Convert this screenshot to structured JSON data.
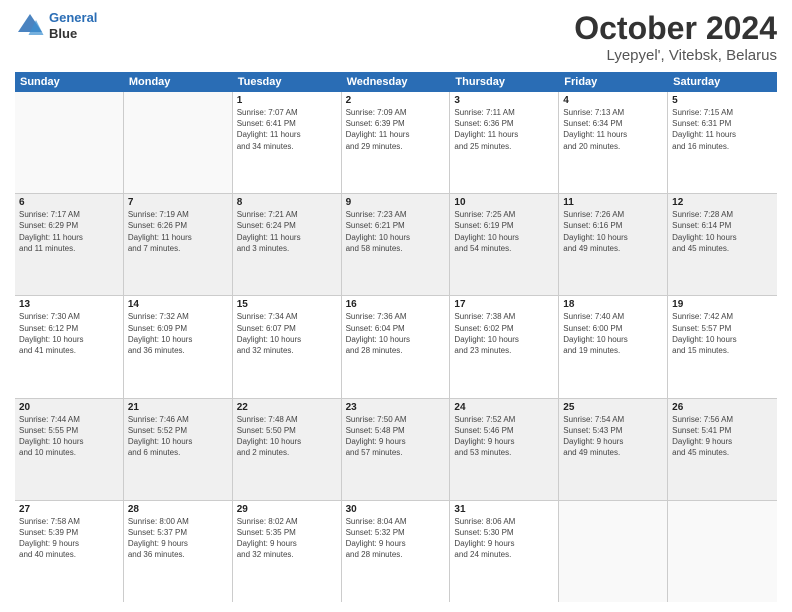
{
  "logo": {
    "line1": "General",
    "line2": "Blue"
  },
  "title": "October 2024",
  "subtitle": "Lyepyel', Vitebsk, Belarus",
  "days": [
    "Sunday",
    "Monday",
    "Tuesday",
    "Wednesday",
    "Thursday",
    "Friday",
    "Saturday"
  ],
  "weeks": [
    [
      {
        "day": "",
        "content": ""
      },
      {
        "day": "",
        "content": ""
      },
      {
        "day": "1",
        "content": "Sunrise: 7:07 AM\nSunset: 6:41 PM\nDaylight: 11 hours\nand 34 minutes."
      },
      {
        "day": "2",
        "content": "Sunrise: 7:09 AM\nSunset: 6:39 PM\nDaylight: 11 hours\nand 29 minutes."
      },
      {
        "day": "3",
        "content": "Sunrise: 7:11 AM\nSunset: 6:36 PM\nDaylight: 11 hours\nand 25 minutes."
      },
      {
        "day": "4",
        "content": "Sunrise: 7:13 AM\nSunset: 6:34 PM\nDaylight: 11 hours\nand 20 minutes."
      },
      {
        "day": "5",
        "content": "Sunrise: 7:15 AM\nSunset: 6:31 PM\nDaylight: 11 hours\nand 16 minutes."
      }
    ],
    [
      {
        "day": "6",
        "content": "Sunrise: 7:17 AM\nSunset: 6:29 PM\nDaylight: 11 hours\nand 11 minutes."
      },
      {
        "day": "7",
        "content": "Sunrise: 7:19 AM\nSunset: 6:26 PM\nDaylight: 11 hours\nand 7 minutes."
      },
      {
        "day": "8",
        "content": "Sunrise: 7:21 AM\nSunset: 6:24 PM\nDaylight: 11 hours\nand 3 minutes."
      },
      {
        "day": "9",
        "content": "Sunrise: 7:23 AM\nSunset: 6:21 PM\nDaylight: 10 hours\nand 58 minutes."
      },
      {
        "day": "10",
        "content": "Sunrise: 7:25 AM\nSunset: 6:19 PM\nDaylight: 10 hours\nand 54 minutes."
      },
      {
        "day": "11",
        "content": "Sunrise: 7:26 AM\nSunset: 6:16 PM\nDaylight: 10 hours\nand 49 minutes."
      },
      {
        "day": "12",
        "content": "Sunrise: 7:28 AM\nSunset: 6:14 PM\nDaylight: 10 hours\nand 45 minutes."
      }
    ],
    [
      {
        "day": "13",
        "content": "Sunrise: 7:30 AM\nSunset: 6:12 PM\nDaylight: 10 hours\nand 41 minutes."
      },
      {
        "day": "14",
        "content": "Sunrise: 7:32 AM\nSunset: 6:09 PM\nDaylight: 10 hours\nand 36 minutes."
      },
      {
        "day": "15",
        "content": "Sunrise: 7:34 AM\nSunset: 6:07 PM\nDaylight: 10 hours\nand 32 minutes."
      },
      {
        "day": "16",
        "content": "Sunrise: 7:36 AM\nSunset: 6:04 PM\nDaylight: 10 hours\nand 28 minutes."
      },
      {
        "day": "17",
        "content": "Sunrise: 7:38 AM\nSunset: 6:02 PM\nDaylight: 10 hours\nand 23 minutes."
      },
      {
        "day": "18",
        "content": "Sunrise: 7:40 AM\nSunset: 6:00 PM\nDaylight: 10 hours\nand 19 minutes."
      },
      {
        "day": "19",
        "content": "Sunrise: 7:42 AM\nSunset: 5:57 PM\nDaylight: 10 hours\nand 15 minutes."
      }
    ],
    [
      {
        "day": "20",
        "content": "Sunrise: 7:44 AM\nSunset: 5:55 PM\nDaylight: 10 hours\nand 10 minutes."
      },
      {
        "day": "21",
        "content": "Sunrise: 7:46 AM\nSunset: 5:52 PM\nDaylight: 10 hours\nand 6 minutes."
      },
      {
        "day": "22",
        "content": "Sunrise: 7:48 AM\nSunset: 5:50 PM\nDaylight: 10 hours\nand 2 minutes."
      },
      {
        "day": "23",
        "content": "Sunrise: 7:50 AM\nSunset: 5:48 PM\nDaylight: 9 hours\nand 57 minutes."
      },
      {
        "day": "24",
        "content": "Sunrise: 7:52 AM\nSunset: 5:46 PM\nDaylight: 9 hours\nand 53 minutes."
      },
      {
        "day": "25",
        "content": "Sunrise: 7:54 AM\nSunset: 5:43 PM\nDaylight: 9 hours\nand 49 minutes."
      },
      {
        "day": "26",
        "content": "Sunrise: 7:56 AM\nSunset: 5:41 PM\nDaylight: 9 hours\nand 45 minutes."
      }
    ],
    [
      {
        "day": "27",
        "content": "Sunrise: 7:58 AM\nSunset: 5:39 PM\nDaylight: 9 hours\nand 40 minutes."
      },
      {
        "day": "28",
        "content": "Sunrise: 8:00 AM\nSunset: 5:37 PM\nDaylight: 9 hours\nand 36 minutes."
      },
      {
        "day": "29",
        "content": "Sunrise: 8:02 AM\nSunset: 5:35 PM\nDaylight: 9 hours\nand 32 minutes."
      },
      {
        "day": "30",
        "content": "Sunrise: 8:04 AM\nSunset: 5:32 PM\nDaylight: 9 hours\nand 28 minutes."
      },
      {
        "day": "31",
        "content": "Sunrise: 8:06 AM\nSunset: 5:30 PM\nDaylight: 9 hours\nand 24 minutes."
      },
      {
        "day": "",
        "content": ""
      },
      {
        "day": "",
        "content": ""
      }
    ]
  ]
}
